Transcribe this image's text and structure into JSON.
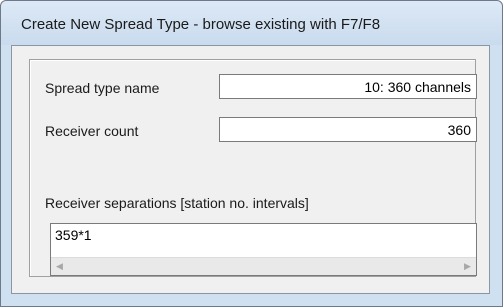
{
  "window": {
    "title": "Create New Spread Type - browse existing with F7/F8"
  },
  "form": {
    "spread_type_name_label": "Spread type name",
    "spread_type_name_value": "10: 360 channels",
    "receiver_count_label": "Receiver count",
    "receiver_count_value": "360",
    "receiver_separations_label": "Receiver separations [station no. intervals]",
    "receiver_separations_value": "359*1"
  },
  "icons": {
    "scroll_left": "scroll-left-arrow-icon",
    "scroll_right": "scroll-right-arrow-icon"
  }
}
